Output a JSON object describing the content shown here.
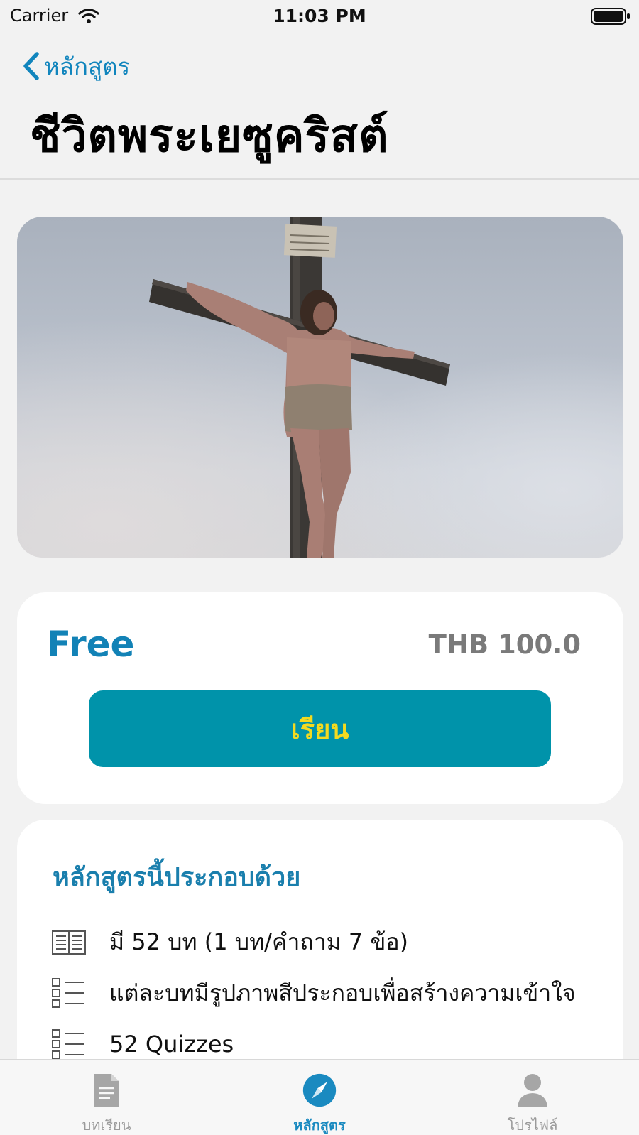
{
  "status_bar": {
    "carrier": "Carrier",
    "time": "11:03 PM"
  },
  "nav": {
    "back_label": "หลักสูตร",
    "title": "ชีวิตพระเยซูคริสต์"
  },
  "hero": {
    "image": "crucifixion-photo"
  },
  "pricing": {
    "price_label": "Free",
    "original_price": "THB 100.0",
    "learn_button": "เรียน"
  },
  "course_info": {
    "heading": "หลักสูตรนี้ประกอบด้วย",
    "items": [
      {
        "icon": "book-icon",
        "text": "มี 52 บท (1 บท/คำถาม 7 ข้อ)"
      },
      {
        "icon": "checklist-icon",
        "text": "แต่ละบทมีรูปภาพสีประกอบเพื่อสร้างความเข้าใจ"
      },
      {
        "icon": "checklist-icon",
        "text": "52 Quizzes"
      }
    ]
  },
  "tab_bar": {
    "tabs": [
      {
        "label": "บทเรียน",
        "icon": "document-icon",
        "active": false
      },
      {
        "label": "หลักสูตร",
        "icon": "compass-icon",
        "active": true
      },
      {
        "label": "โปรไฟล์",
        "icon": "person-icon",
        "active": false
      }
    ]
  },
  "colors": {
    "accent": "#1282b6",
    "button": "#0093aa",
    "button_text": "#f3da1f"
  }
}
